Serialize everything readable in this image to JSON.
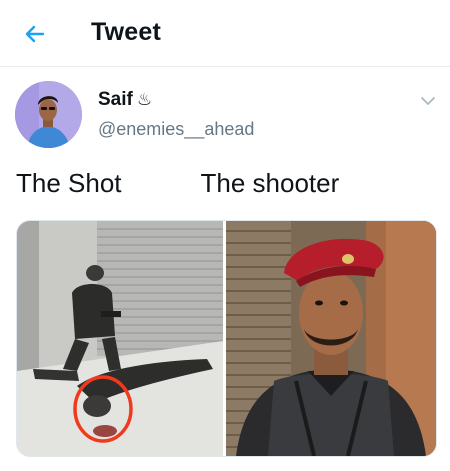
{
  "header": {
    "title": "Tweet",
    "back_icon": "arrow-left-icon",
    "accent_color": "#1da1f2"
  },
  "tweet": {
    "author": {
      "name": "Saif",
      "name_glyph": "♨",
      "handle": "@enemies__ahead"
    },
    "text": "The Shot           The shooter",
    "menu_icon": "chevron-down-icon",
    "media": [
      {
        "label": "photo-1"
      },
      {
        "label": "photo-2"
      }
    ]
  }
}
